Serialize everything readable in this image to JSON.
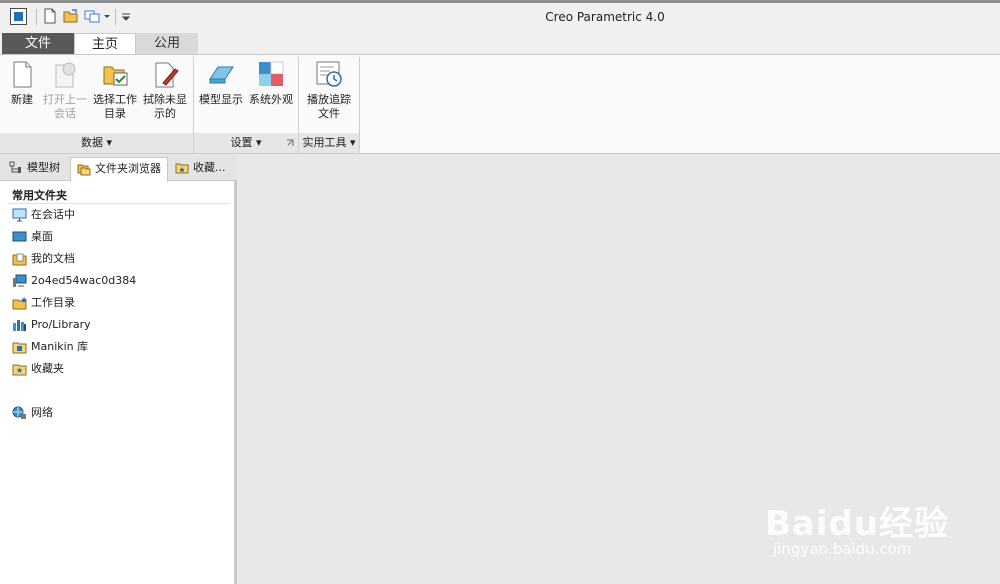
{
  "window": {
    "title": "Creo Parametric 4.0"
  },
  "tabs": [
    {
      "label": "文件"
    },
    {
      "label": "主页"
    },
    {
      "label": "公用"
    }
  ],
  "ribbon": {
    "buttons": [
      {
        "label1": "新建",
        "label2": "",
        "icon": "new-document-icon",
        "enabled": true
      },
      {
        "label1": "打开上一",
        "label2": "会话",
        "icon": "open-last-session-icon",
        "enabled": false
      },
      {
        "label1": "选择工作",
        "label2": "目录",
        "icon": "select-working-directory-icon",
        "enabled": true
      },
      {
        "label1": "拭除未显",
        "label2": "示的",
        "icon": "erase-not-displayed-icon",
        "enabled": true
      },
      {
        "label1": "模型显示",
        "label2": "",
        "icon": "model-display-icon",
        "enabled": true
      },
      {
        "label1": "系统外观",
        "label2": "",
        "icon": "system-appearance-icon",
        "enabled": true
      },
      {
        "label1": "播放追踪",
        "label2": "文件",
        "icon": "play-trail-file-icon",
        "enabled": true
      }
    ],
    "groups": [
      {
        "label": "数据 ▾"
      },
      {
        "label": "设置 ▾"
      },
      {
        "label": "实用工具 ▾"
      }
    ]
  },
  "left_panel": {
    "tabs": [
      {
        "label": "模型树"
      },
      {
        "label": "文件夹浏览器"
      },
      {
        "label": "收藏..."
      }
    ],
    "section_title": "常用文件夹",
    "items": [
      {
        "label": "在会话中",
        "icon": "in-session-icon"
      },
      {
        "label": "桌面",
        "icon": "desktop-icon"
      },
      {
        "label": "我的文档",
        "icon": "my-documents-icon"
      },
      {
        "label": "2o4ed54wac0d384",
        "icon": "computer-icon"
      },
      {
        "label": "工作目录",
        "icon": "working-directory-icon"
      },
      {
        "label": "Pro/Library",
        "icon": "library-icon"
      },
      {
        "label": "Manikin 库",
        "icon": "manikin-library-icon"
      },
      {
        "label": "收藏夹",
        "icon": "favorites-icon"
      },
      {
        "label": "网络",
        "icon": "network-icon"
      }
    ]
  },
  "watermark": {
    "brand": "Baidu经验",
    "url": "jingyan.baidu.com"
  },
  "colors": {
    "accent": "#1f6fb4",
    "file_tab": "#595959",
    "background": "#e8e8e8"
  }
}
